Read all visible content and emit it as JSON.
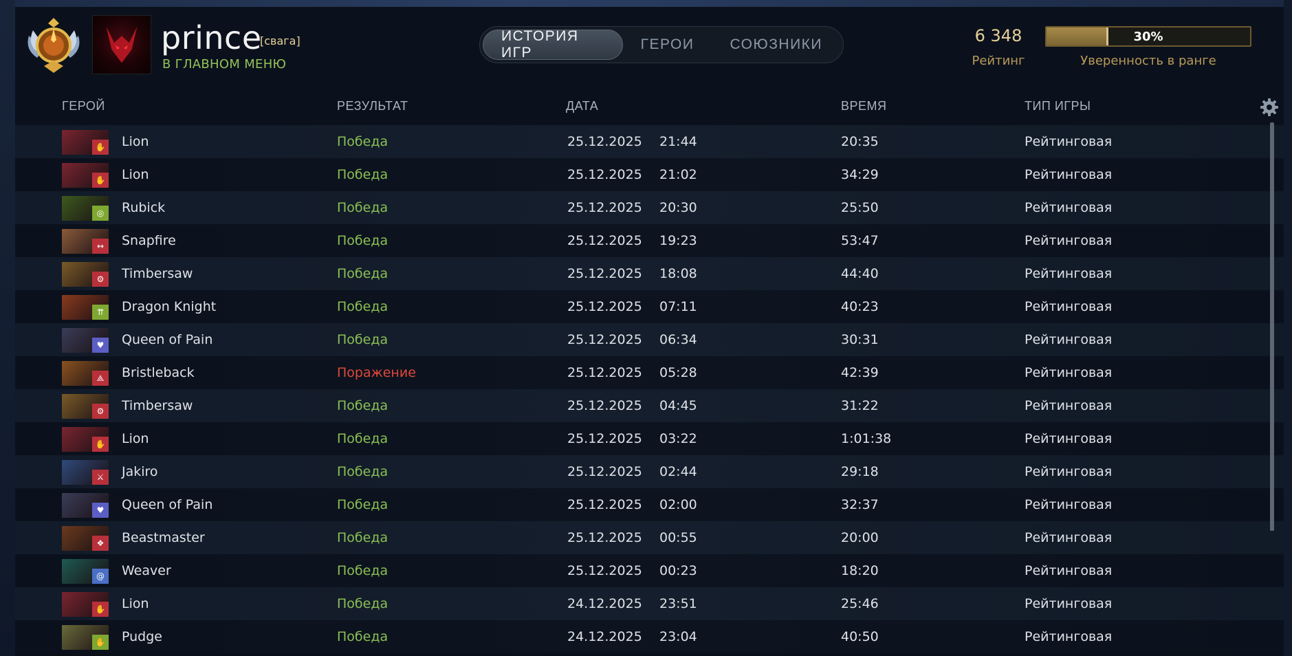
{
  "profile": {
    "username": "prince",
    "tag": "[свага]",
    "status": "В ГЛАВНОМ МЕНЮ"
  },
  "tabs": [
    {
      "label": "ИСТОРИЯ ИГР",
      "active": true
    },
    {
      "label": "ГЕРОИ",
      "active": false
    },
    {
      "label": "СОЮЗНИКИ",
      "active": false
    }
  ],
  "rating": {
    "value": "6 348",
    "label": "Рейтинг"
  },
  "confidence": {
    "percent": 30,
    "text": "30%",
    "label": "Уверенность в ранге"
  },
  "table": {
    "columns": [
      "ГЕРОЙ",
      "РЕЗУЛЬТАТ",
      "ДАТА",
      "ВРЕМЯ",
      "ТИП ИГРЫ"
    ],
    "rows": [
      {
        "hero": "Lion",
        "result": "Победа",
        "win": true,
        "date": "25.12.2025",
        "time": "21:44",
        "duration": "20:35",
        "type": "Рейтинговая",
        "color": "#7a2530",
        "facet": "#b8313a",
        "icon": "hand-icon"
      },
      {
        "hero": "Lion",
        "result": "Победа",
        "win": true,
        "date": "25.12.2025",
        "time": "21:02",
        "duration": "34:29",
        "type": "Рейтинговая",
        "color": "#7a2530",
        "facet": "#b8313a",
        "icon": "hand-icon"
      },
      {
        "hero": "Rubick",
        "result": "Победа",
        "win": true,
        "date": "25.12.2025",
        "time": "20:30",
        "duration": "25:50",
        "type": "Рейтинговая",
        "color": "#3c5a1e",
        "facet": "#7fa832",
        "icon": "circle-icon"
      },
      {
        "hero": "Snapfire",
        "result": "Победа",
        "win": true,
        "date": "25.12.2025",
        "time": "19:23",
        "duration": "53:47",
        "type": "Рейтинговая",
        "color": "#8a5a3a",
        "facet": "#b8313a",
        "icon": "arrows-icon"
      },
      {
        "hero": "Timbersaw",
        "result": "Победа",
        "win": true,
        "date": "25.12.2025",
        "time": "18:08",
        "duration": "44:40",
        "type": "Рейтинговая",
        "color": "#7a5a28",
        "facet": "#b8313a",
        "icon": "gear-icon"
      },
      {
        "hero": "Dragon Knight",
        "result": "Победа",
        "win": true,
        "date": "25.12.2025",
        "time": "07:11",
        "duration": "40:23",
        "type": "Рейтинговая",
        "color": "#8a3a1e",
        "facet": "#7fa832",
        "icon": "arrow-up-icon"
      },
      {
        "hero": "Queen of Pain",
        "result": "Победа",
        "win": true,
        "date": "25.12.2025",
        "time": "06:34",
        "duration": "30:31",
        "type": "Рейтинговая",
        "color": "#3a3d58",
        "facet": "#5b5fc4",
        "icon": "heart-icon"
      },
      {
        "hero": "Bristleback",
        "result": "Поражение",
        "win": false,
        "date": "25.12.2025",
        "time": "05:28",
        "duration": "42:39",
        "type": "Рейтинговая",
        "color": "#8a5220",
        "facet": "#b8313a",
        "icon": "spike-icon"
      },
      {
        "hero": "Timbersaw",
        "result": "Победа",
        "win": true,
        "date": "25.12.2025",
        "time": "04:45",
        "duration": "31:22",
        "type": "Рейтинговая",
        "color": "#7a5a28",
        "facet": "#b8313a",
        "icon": "gear-icon"
      },
      {
        "hero": "Lion",
        "result": "Победа",
        "win": true,
        "date": "25.12.2025",
        "time": "03:22",
        "duration": "1:01:38",
        "type": "Рейтинговая",
        "color": "#7a2530",
        "facet": "#b8313a",
        "icon": "hand-icon"
      },
      {
        "hero": "Jakiro",
        "result": "Победа",
        "win": true,
        "date": "25.12.2025",
        "time": "02:44",
        "duration": "29:18",
        "type": "Рейтинговая",
        "color": "#2f4a7a",
        "facet": "#b8313a",
        "icon": "sword-icon"
      },
      {
        "hero": "Queen of Pain",
        "result": "Победа",
        "win": true,
        "date": "25.12.2025",
        "time": "02:00",
        "duration": "32:37",
        "type": "Рейтинговая",
        "color": "#3a3d58",
        "facet": "#5b5fc4",
        "icon": "heart-icon"
      },
      {
        "hero": "Beastmaster",
        "result": "Победа",
        "win": true,
        "date": "25.12.2025",
        "time": "00:55",
        "duration": "20:00",
        "type": "Рейтинговая",
        "color": "#6a3a1e",
        "facet": "#b8313a",
        "icon": "paw-icon"
      },
      {
        "hero": "Weaver",
        "result": "Победа",
        "win": true,
        "date": "25.12.2025",
        "time": "00:23",
        "duration": "18:20",
        "type": "Рейтинговая",
        "color": "#1e5a52",
        "facet": "#4a6fc4",
        "icon": "spiral-icon"
      },
      {
        "hero": "Lion",
        "result": "Победа",
        "win": true,
        "date": "24.12.2025",
        "time": "23:51",
        "duration": "25:46",
        "type": "Рейтинговая",
        "color": "#7a2530",
        "facet": "#b8313a",
        "icon": "hand-icon"
      },
      {
        "hero": "Pudge",
        "result": "Победа",
        "win": true,
        "date": "24.12.2025",
        "time": "23:04",
        "duration": "40:50",
        "type": "Рейтинговая",
        "color": "#6a6a3a",
        "facet": "#7fa832",
        "icon": "hand-icon"
      }
    ]
  },
  "colors": {
    "win": "#8ac054",
    "loss": "#e0483a",
    "gold": "#e5cf96"
  }
}
